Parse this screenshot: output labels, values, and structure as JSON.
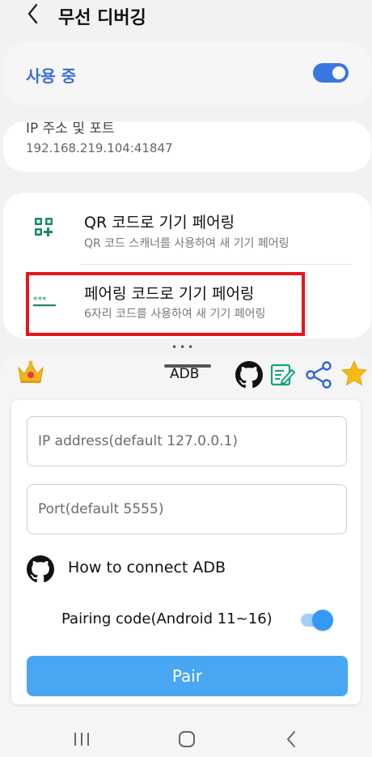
{
  "settings": {
    "title": "무선 디버깅",
    "in_use": {
      "label": "사용 중",
      "enabled": true
    },
    "ip": {
      "label": "IP 주소 및 포트",
      "value": "192.168.219.104:41847"
    },
    "pairing_rows": [
      {
        "title": "QR 코드로 기기 페어링",
        "subtitle": "QR 코드 스캐너를 사용하여 새 기기 페어링",
        "icon": "qr-code-icon"
      },
      {
        "title": "페어링 코드로 기기 페어링",
        "subtitle": "6자리 코드를 사용하여 새 기기 페어링",
        "icon": "pairing-code-icon"
      }
    ],
    "highlight_color": "#e8141b"
  },
  "adb_app": {
    "title": "ADB",
    "header_icons": [
      "crown-icon",
      "github-icon",
      "edit-note-icon",
      "share-icon",
      "star-icon"
    ],
    "ip_placeholder": "IP address(default 127.0.0.1)",
    "port_placeholder": "Port(default 5555)",
    "howto_label": "How to connect ADB",
    "pairing_code_label": "Pairing code(Android 11~16)",
    "pairing_code_enabled": true,
    "pair_button": "Pair",
    "accent_color": "#48a6f3"
  },
  "navbar": {
    "icons": [
      "recent-apps-icon",
      "home-icon",
      "back-icon"
    ]
  }
}
